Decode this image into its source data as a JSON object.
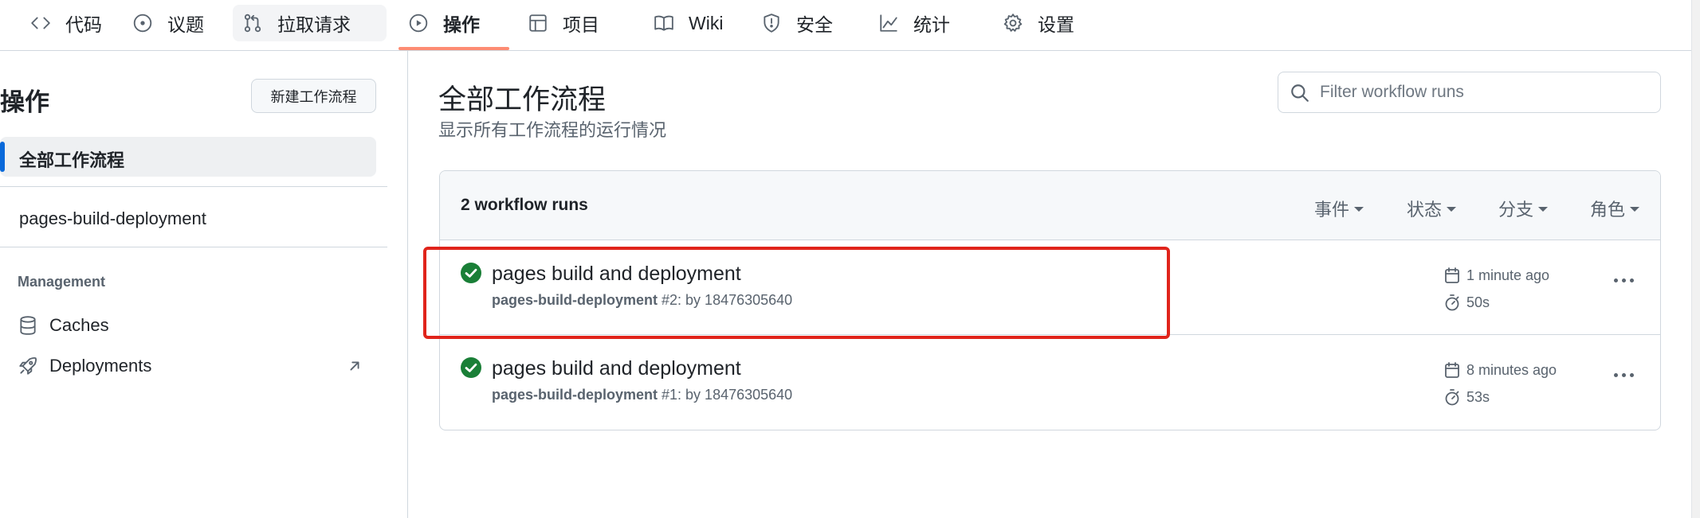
{
  "nav": {
    "items": [
      {
        "label": "代码",
        "icon": "code-icon"
      },
      {
        "label": "议题",
        "icon": "issue-icon"
      },
      {
        "label": "拉取请求",
        "icon": "pull-request-icon"
      },
      {
        "label": "操作",
        "icon": "play-icon"
      },
      {
        "label": "项目",
        "icon": "table-icon"
      },
      {
        "label": "Wiki",
        "icon": "book-icon"
      },
      {
        "label": "安全",
        "icon": "shield-icon"
      },
      {
        "label": "统计",
        "icon": "graph-icon"
      },
      {
        "label": "设置",
        "icon": "gear-icon"
      }
    ],
    "active_index": 3,
    "active_underline_color": "#fd8c73"
  },
  "sidebar": {
    "title": "操作",
    "new_workflow_label": "新建工作流程",
    "selected_item": "全部工作流程",
    "workflow": "pages-build-deployment",
    "management_heading": "Management",
    "links": [
      {
        "label": "Caches",
        "icon": "database-icon"
      },
      {
        "label": "Deployments",
        "icon": "rocket-icon",
        "external": true
      }
    ],
    "selected_color": "#0969da"
  },
  "main": {
    "title": "全部工作流程",
    "subtitle": "显示所有工作流程的运行情况",
    "filter_placeholder": "Filter workflow runs",
    "runs_count": "2 workflow runs",
    "filters": [
      "事件",
      "状态",
      "分支",
      "角色"
    ],
    "runs": [
      {
        "title": "pages build and deployment",
        "workflow": "pages-build-deployment",
        "rest": " #2: by 18476305640",
        "time": "1 minute ago",
        "duration": "50s",
        "status": "success"
      },
      {
        "title": "pages build and deployment",
        "workflow": "pages-build-deployment",
        "rest": " #1: by 18476305640",
        "time": "8 minutes ago",
        "duration": "53s",
        "status": "success"
      }
    ],
    "success_color": "#1a7f37",
    "highlight_color": "#e0241b"
  }
}
